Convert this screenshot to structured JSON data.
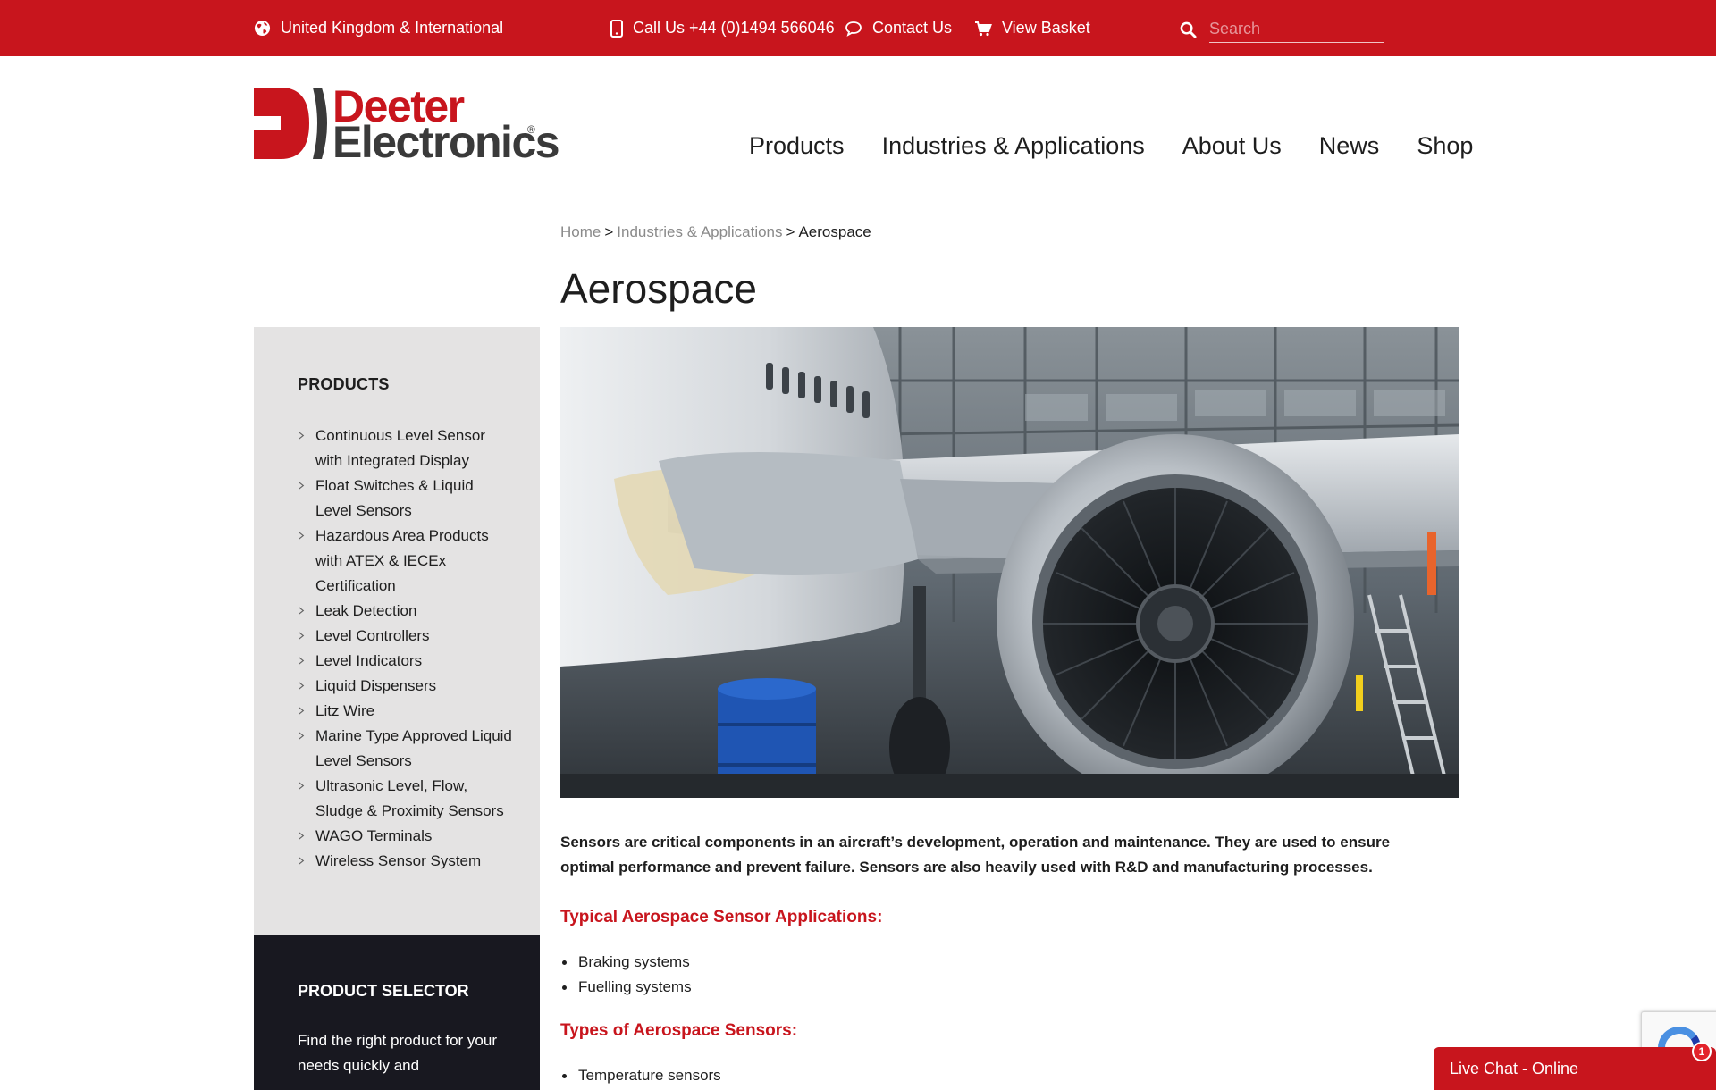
{
  "topbar": {
    "region": "United Kingdom & International",
    "phone": "Call Us +44 (0)1494 566046",
    "contact": "Contact Us",
    "basket": "View Basket",
    "search_placeholder": "Search"
  },
  "logo": {
    "line1": "Deeter",
    "line2": "Electronics",
    "reg": "®"
  },
  "nav": [
    "Products",
    "Industries & Applications",
    "About Us",
    "News",
    "Shop"
  ],
  "breadcrumb": {
    "home": "Home",
    "section": "Industries & Applications",
    "current": "Aerospace",
    "separator": ">"
  },
  "page_title": "Aerospace",
  "sidebar": {
    "heading": "PRODUCTS",
    "items": [
      "Continuous Level Sensor with Integrated Display",
      "Float Switches & Liquid Level Sensors",
      "Hazardous Area Products with ATEX & IECEx Certification",
      "Leak Detection",
      "Level Controllers",
      "Level Indicators",
      "Liquid Dispensers",
      "Litz Wire",
      "Marine Type Approved Liquid Level Sensors",
      "Ultrasonic Level, Flow, Sludge & Proximity Sensors",
      "WAGO Terminals",
      "Wireless Sensor System"
    ]
  },
  "selector": {
    "heading": "PRODUCT SELECTOR",
    "text": "Find the right product for your needs quickly and"
  },
  "content": {
    "intro": "Sensors are critical components in an aircraft’s development, operation and maintenance. They are used to ensure optimal performance and prevent failure. Sensors are also heavily used with R&D and manufacturing processes.",
    "applications_heading": "Typical Aerospace Sensor Applications:",
    "applications": [
      "Braking systems",
      "Fuelling systems"
    ],
    "types_heading": "Types of Aerospace Sensors:",
    "types": [
      "Temperature sensors"
    ]
  },
  "chat": {
    "label": "Live Chat - Online",
    "badge": "1"
  },
  "colors": {
    "brand_red": "#c8151d",
    "sidebar_grey": "#e4e3e3",
    "selector_dark": "#181820"
  }
}
